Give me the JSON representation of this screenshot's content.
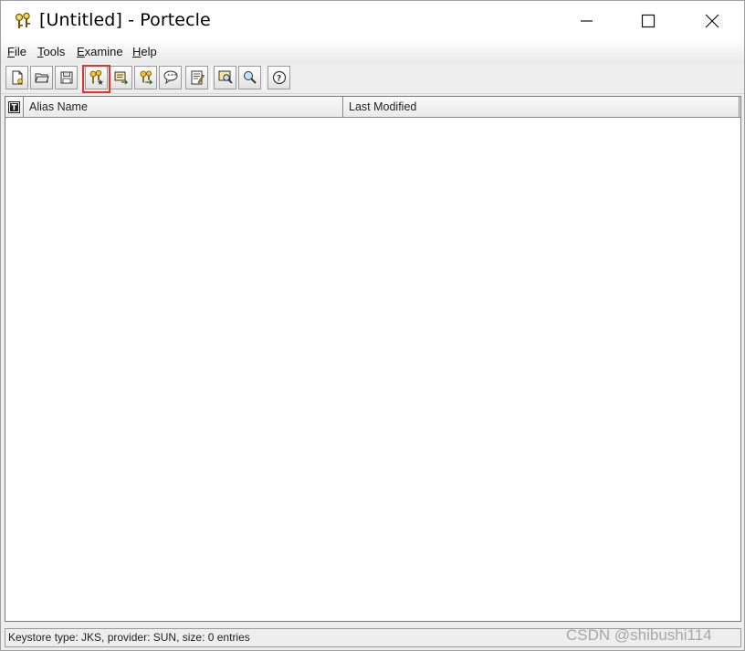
{
  "window": {
    "title": "[Untitled] - Portecle",
    "app_icon": "portecle-keys-icon",
    "controls": [
      "minimize-icon",
      "maximize-icon",
      "close-icon"
    ]
  },
  "menubar": {
    "items": [
      {
        "label": "File",
        "mnemonic": "F",
        "rest": "ile"
      },
      {
        "label": "Tools",
        "mnemonic": "T",
        "rest": "ools"
      },
      {
        "label": "Examine",
        "mnemonic": "E",
        "rest": "xamine"
      },
      {
        "label": "Help",
        "mnemonic": "H",
        "rest": "elp"
      }
    ]
  },
  "toolbar": {
    "buttons": [
      {
        "icon": "new-keystore-icon"
      },
      {
        "icon": "open-keystore-icon"
      },
      {
        "icon": "save-keystore-icon"
      },
      {
        "icon": "generate-key-pair-icon",
        "highlighted": true
      },
      {
        "icon": "import-trusted-certificate-icon"
      },
      {
        "icon": "import-key-pair-icon"
      },
      {
        "icon": "set-keystore-password-icon"
      },
      {
        "icon": "keystore-report-icon"
      },
      {
        "icon": "examine-certificate-icon"
      },
      {
        "icon": "examine-crl-icon"
      },
      {
        "icon": "help-icon"
      }
    ],
    "highlight_color": "#e8312b"
  },
  "table": {
    "columns": [
      {
        "label": "",
        "icon": "entry-type-icon"
      },
      {
        "label": "Alias Name"
      },
      {
        "label": "Last Modified"
      }
    ],
    "rows": []
  },
  "statusbar": {
    "text": "Keystore type: JKS, provider: SUN, size: 0 entries"
  },
  "watermark": {
    "text": "CSDN @shibushi114"
  }
}
